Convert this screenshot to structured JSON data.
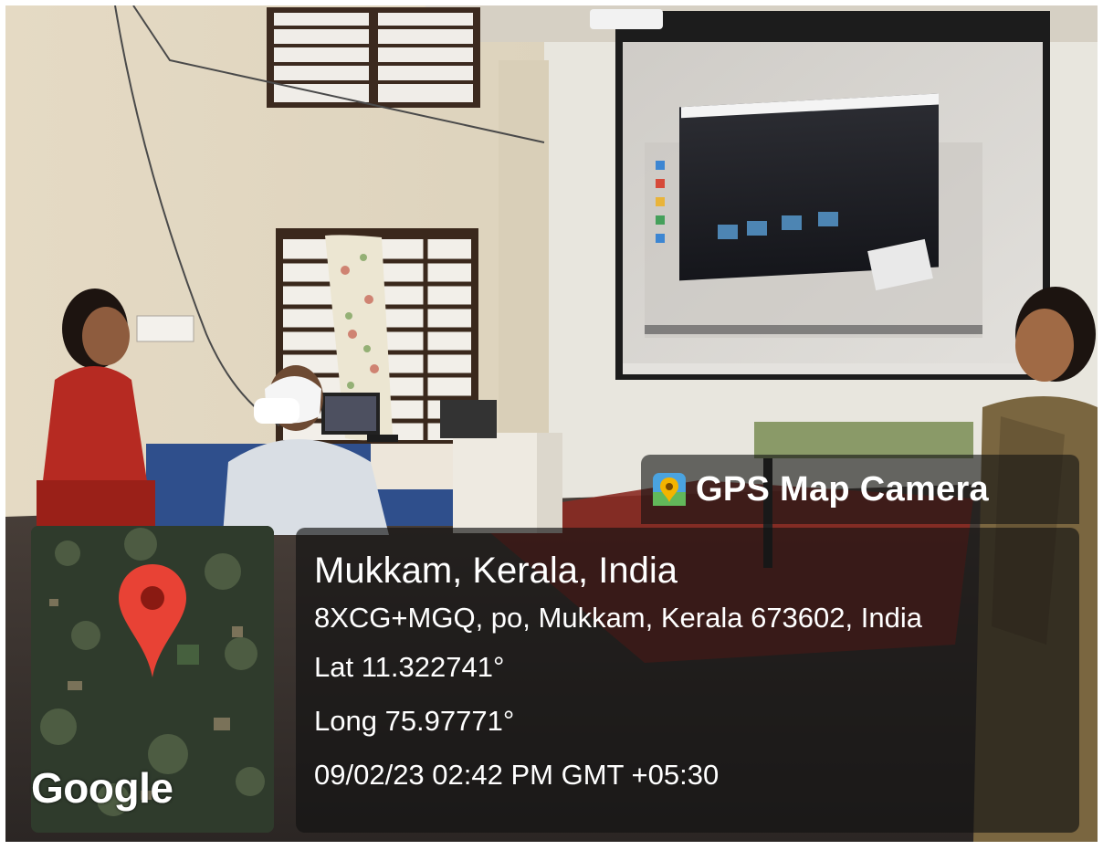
{
  "overlay": {
    "brand_label": "GPS Map Camera",
    "brand_icon": "map-pin-app-icon",
    "location_title": "Mukkam, Kerala, India",
    "address": "8XCG+MGQ, po, Mukkam, Kerala 673602, India",
    "latitude": "Lat 11.322741°",
    "longitude": "Long 75.97771°",
    "timestamp": "09/02/23 02:42 PM GMT +05:30"
  },
  "map_thumbnail": {
    "attribution": "Google",
    "marker_icon": "location-pin-icon",
    "marker_color": "#e84235"
  },
  "colors": {
    "panel_bg": "#121212",
    "text": "#ffffff",
    "wall": "#e6dcc6",
    "screen": "#d8d6d2"
  }
}
